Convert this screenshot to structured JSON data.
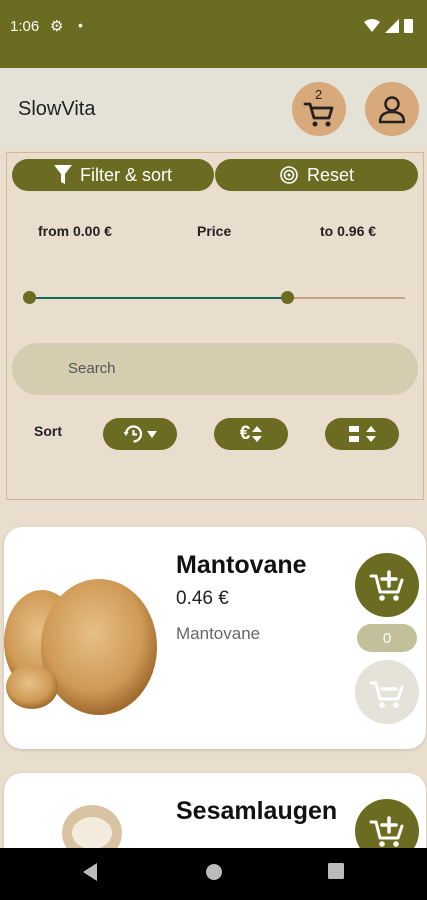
{
  "status": {
    "time": "1:06"
  },
  "app": {
    "title": "SlowVita",
    "cart_count": "2"
  },
  "filter": {
    "filter_label": "Filter & sort",
    "reset_label": "Reset",
    "price_from": "from 0.00 €",
    "price_label": "Price",
    "price_to": "to 0.96 €",
    "slider_low_fraction": 0,
    "slider_high_fraction": 0.69,
    "search_placeholder": "Search",
    "sort_label": "Sort"
  },
  "products": [
    {
      "name": "Mantovane",
      "price": "0.46 €",
      "subtitle": "Mantovane",
      "quantity": "0"
    },
    {
      "name": "Sesamlaugen"
    }
  ],
  "colors": {
    "primary": "#6b6b21",
    "accent": "#d8a97a",
    "background": "#e9ddcd",
    "slider_fill": "#0f6b62"
  }
}
